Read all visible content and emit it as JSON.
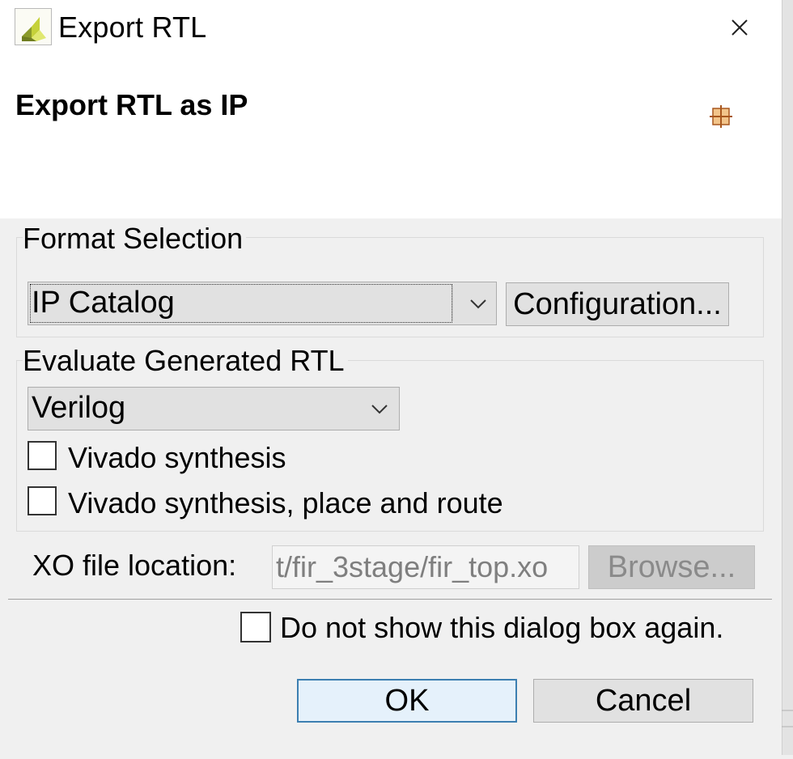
{
  "window": {
    "title": "Export RTL",
    "app_icon": "xilinx-logo-icon",
    "close_icon": "close-icon"
  },
  "header": {
    "title": "Export RTL as IP",
    "icon": "crosshair-grid-icon"
  },
  "format_selection": {
    "legend": "Format Selection",
    "selected": "IP Catalog",
    "configuration_label": "Configuration..."
  },
  "evaluate": {
    "legend": "Evaluate Generated RTL",
    "language": "Verilog",
    "options": [
      {
        "label": "Vivado synthesis",
        "checked": false
      },
      {
        "label": "Vivado synthesis, place and route",
        "checked": false
      }
    ]
  },
  "xo": {
    "label": "XO file location:",
    "value": "t/fir_3stage/fir_top.xo",
    "browse_label": "Browse..."
  },
  "footer": {
    "dont_show_label": "Do not show this dialog box again.",
    "dont_show_checked": false,
    "ok_label": "OK",
    "cancel_label": "Cancel"
  },
  "colors": {
    "accent": "#3c7fb1",
    "dialog_bg": "#f0f0f0",
    "header_bg": "#ffffff"
  }
}
